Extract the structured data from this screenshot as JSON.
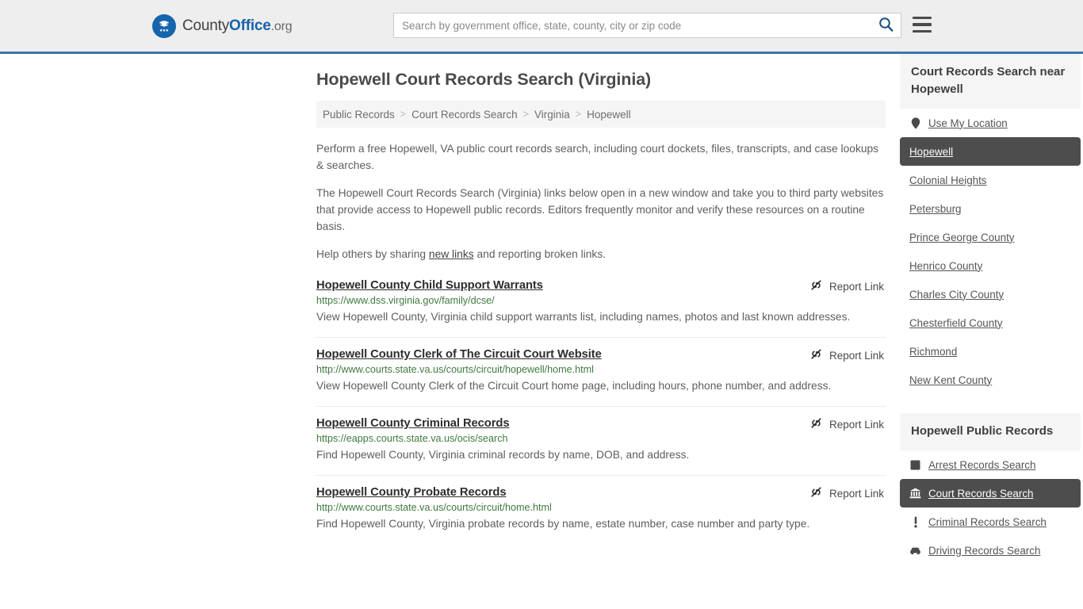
{
  "header": {
    "brand": {
      "part1": "County",
      "part2": "Office",
      "part3": ".org",
      "logo_icon": "eagle-shield-icon"
    },
    "search": {
      "placeholder": "Search by government office, state, county, city or zip code",
      "value": "",
      "search_icon": "search-icon"
    },
    "menu_icon": "hamburger-menu-icon",
    "accent_color": "#3a78ad"
  },
  "main": {
    "title": "Hopewell Court Records Search (Virginia)",
    "breadcrumb": [
      {
        "label": "Public Records"
      },
      {
        "label": "Court Records Search"
      },
      {
        "label": "Virginia"
      },
      {
        "label": "Hopewell"
      }
    ],
    "breadcrumb_separator": ">",
    "intro": [
      "Perform a free Hopewell, VA public court records search, including court dockets, files, transcripts, and case lookups & searches.",
      "The Hopewell Court Records Search (Virginia) links below open in a new window and take you to third party websites that provide access to Hopewell public records. Editors frequently monitor and verify these resources on a routine basis."
    ],
    "help_line": {
      "before": "Help others by sharing ",
      "link": "new links",
      "after": " and reporting broken links."
    },
    "report_link_label": "Report Link",
    "report_link_icon": "broken-link-icon",
    "results": [
      {
        "title": "Hopewell County Child Support Warrants",
        "url": "https://www.dss.virginia.gov/family/dcse/",
        "description": "View Hopewell County, Virginia child support warrants list, including names, photos and last known addresses."
      },
      {
        "title": "Hopewell County Clerk of The Circuit Court Website",
        "url": "http://www.courts.state.va.us/courts/circuit/hopewell/home.html",
        "description": "View Hopewell County Clerk of the Circuit Court home page, including hours, phone number, and address."
      },
      {
        "title": "Hopewell County Criminal Records",
        "url": "https://eapps.courts.state.va.us/ocis/search",
        "description": "Find Hopewell County, Virginia criminal records by name, DOB, and address."
      },
      {
        "title": "Hopewell County Probate Records",
        "url": "http://www.courts.state.va.us/courts/circuit/home.html",
        "description": "Find Hopewell County, Virginia probate records by name, estate number, case number and party type."
      }
    ]
  },
  "sidebar": {
    "nearby": {
      "heading": "Court Records Search near Hopewell",
      "items": [
        {
          "label": "Use My Location",
          "icon": "map-pin-icon",
          "active": false
        },
        {
          "label": "Hopewell",
          "icon": "",
          "active": true
        },
        {
          "label": "Colonial Heights",
          "icon": "",
          "active": false
        },
        {
          "label": "Petersburg",
          "icon": "",
          "active": false
        },
        {
          "label": "Prince George County",
          "icon": "",
          "active": false
        },
        {
          "label": "Henrico County",
          "icon": "",
          "active": false
        },
        {
          "label": "Charles City County",
          "icon": "",
          "active": false
        },
        {
          "label": "Chesterfield County",
          "icon": "",
          "active": false
        },
        {
          "label": "Richmond",
          "icon": "",
          "active": false
        },
        {
          "label": "New Kent County",
          "icon": "",
          "active": false
        }
      ]
    },
    "public_records": {
      "heading": "Hopewell Public Records",
      "items": [
        {
          "label": "Arrest Records Search",
          "icon": "fingerprint-square-icon",
          "active": false
        },
        {
          "label": "Court Records Search",
          "icon": "courthouse-icon",
          "active": true
        },
        {
          "label": "Criminal Records Search",
          "icon": "exclamation-icon",
          "active": false
        },
        {
          "label": "Driving Records Search",
          "icon": "car-icon",
          "active": false
        }
      ]
    },
    "highlight_color": "#4d4d4d"
  }
}
